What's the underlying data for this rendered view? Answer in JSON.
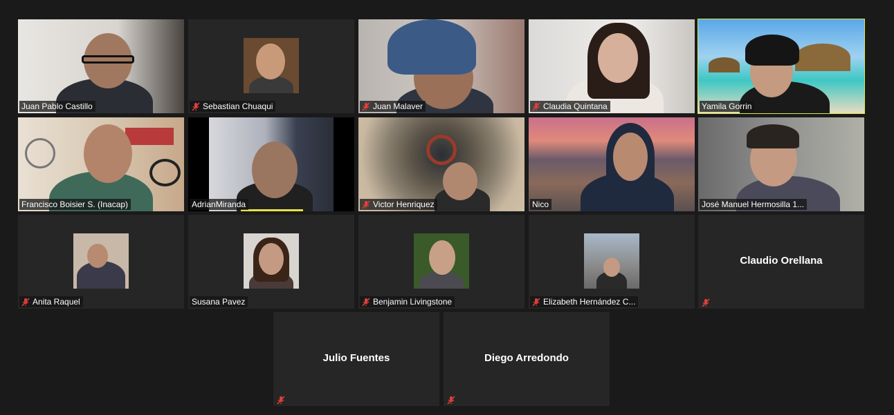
{
  "colors": {
    "background": "#1a1a1a",
    "tile_background": "#262626",
    "active_speaker": "#d6e84a",
    "muted_icon": "#e0403a"
  },
  "participants": [
    {
      "name": "Juan Pablo Castillo",
      "muted": false
    },
    {
      "name": "Sebastian Chuaqui",
      "muted": true
    },
    {
      "name": "Juan Malaver",
      "muted": true
    },
    {
      "name": "Claudia Quintana",
      "muted": true
    },
    {
      "name": "Yamila Gorrin",
      "muted": false
    },
    {
      "name": "Francisco Boisier S. (Inacap)",
      "muted": false
    },
    {
      "name": "AdrianMiranda",
      "muted": false
    },
    {
      "name": "Victor Henriquez",
      "muted": true
    },
    {
      "name": "Nico",
      "muted": false
    },
    {
      "name": "José Manuel Hermosilla 1...",
      "muted": false
    },
    {
      "name": "Anita Raquel",
      "muted": true
    },
    {
      "name": "Susana Pavez",
      "muted": false
    },
    {
      "name": "Benjamin Livingstone",
      "muted": true
    },
    {
      "name": "Elizabeth Hernández C...",
      "muted": true
    },
    {
      "name": "Claudio Orellana",
      "muted": true
    },
    {
      "name": "Julio Fuentes",
      "muted": true
    },
    {
      "name": "Diego Arredondo",
      "muted": true
    }
  ],
  "icons": {
    "muted": "mic-muted-icon"
  }
}
